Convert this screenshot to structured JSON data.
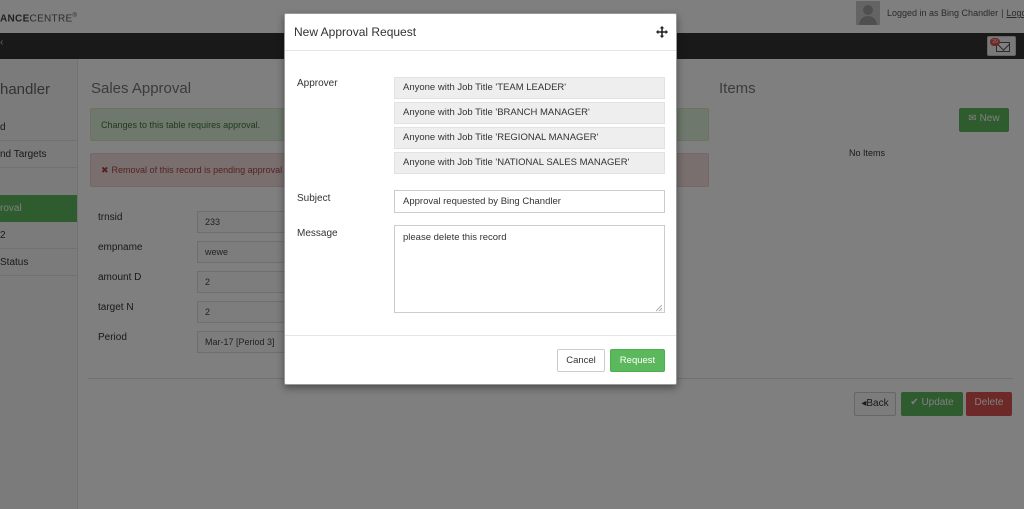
{
  "app": {
    "logo_bold": "ANCE",
    "logo_rest": "CENTRE",
    "logo_mark": "®",
    "login_text": "Logged in as Bing Chandler",
    "separator": "|",
    "logout_label": "Logout"
  },
  "nav": {
    "caret": "‹",
    "badge": "20"
  },
  "sidebar": {
    "title": "handler",
    "items": [
      {
        "label": "d"
      },
      {
        "label": "nd Targets"
      },
      {
        "label": "roval",
        "active": true
      },
      {
        "label": "2"
      },
      {
        "label": "Status"
      }
    ]
  },
  "main": {
    "title": "Sales Approval",
    "alert_success": "Changes to this table requires approval.",
    "alert_danger_icon": "✖",
    "alert_danger": "Removal of this record is pending approval",
    "fields": [
      {
        "label": "trnsid",
        "value": "233"
      },
      {
        "label": "empname",
        "value": "wewe"
      },
      {
        "label": "amount D",
        "value": "2"
      },
      {
        "label": "target N",
        "value": "2"
      },
      {
        "label": "Period",
        "value": "Mar-17 [Period 3]"
      }
    ],
    "back_label": "◂Back",
    "update_label": "✔ Update",
    "delete_label": "Delete"
  },
  "items_panel": {
    "title": "Items",
    "new_label": "✉ New",
    "empty_text": "No Items"
  },
  "modal": {
    "title": "New Approval Request",
    "approver_label": "Approver",
    "approvers": [
      "Anyone with Job Title 'TEAM LEADER'",
      "Anyone with Job Title 'BRANCH MANAGER'",
      "Anyone with Job Title 'REGIONAL MANAGER'",
      "Anyone with Job Title 'NATIONAL SALES MANAGER'"
    ],
    "subject_label": "Subject",
    "subject_value": "Approval requested by Bing Chandler",
    "message_label": "Message",
    "message_value": "please delete this record",
    "cancel_label": "Cancel",
    "request_label": "Request"
  },
  "colors": {
    "primary_green": "#5cb85c",
    "danger_red": "#d9534f",
    "navbar": "#333333"
  }
}
